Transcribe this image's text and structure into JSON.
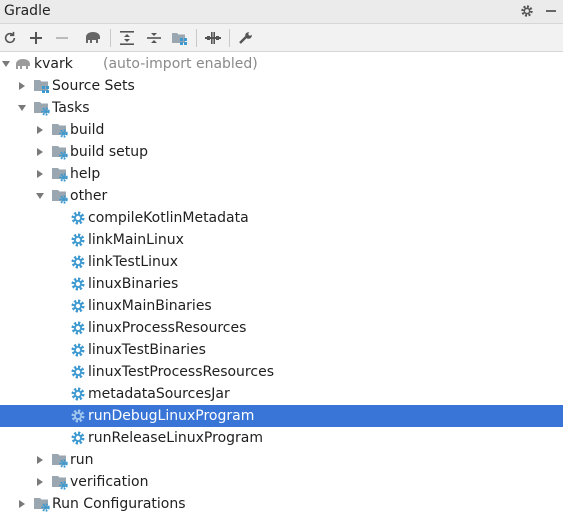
{
  "panel": {
    "title": "Gradle"
  },
  "colors": {
    "selection": "#3875d7",
    "gear": "#3d9ad1",
    "folder": "#9aa7b0"
  },
  "toolbar": {
    "icons": [
      "refresh-icon",
      "add-icon",
      "remove-icon",
      "elephant-icon",
      "expand-all-icon",
      "collapse-all-icon",
      "group-modules-icon",
      "toggle-offline-icon",
      "settings-wrench-icon"
    ]
  },
  "tree": {
    "root": {
      "label": "kvark",
      "suffix": "(auto-import enabled)"
    },
    "source_sets": "Source Sets",
    "tasks": "Tasks",
    "build": "build",
    "build_setup": "build setup",
    "help": "help",
    "other": "other",
    "other_tasks": [
      "compileKotlinMetadata",
      "linkMainLinux",
      "linkTestLinux",
      "linuxBinaries",
      "linuxMainBinaries",
      "linuxProcessResources",
      "linuxTestBinaries",
      "linuxTestProcessResources",
      "metadataSourcesJar",
      "runDebugLinuxProgram",
      "runReleaseLinuxProgram"
    ],
    "selected_task": "runDebugLinuxProgram",
    "run": "run",
    "verification": "verification",
    "run_configurations": "Run Configurations"
  }
}
